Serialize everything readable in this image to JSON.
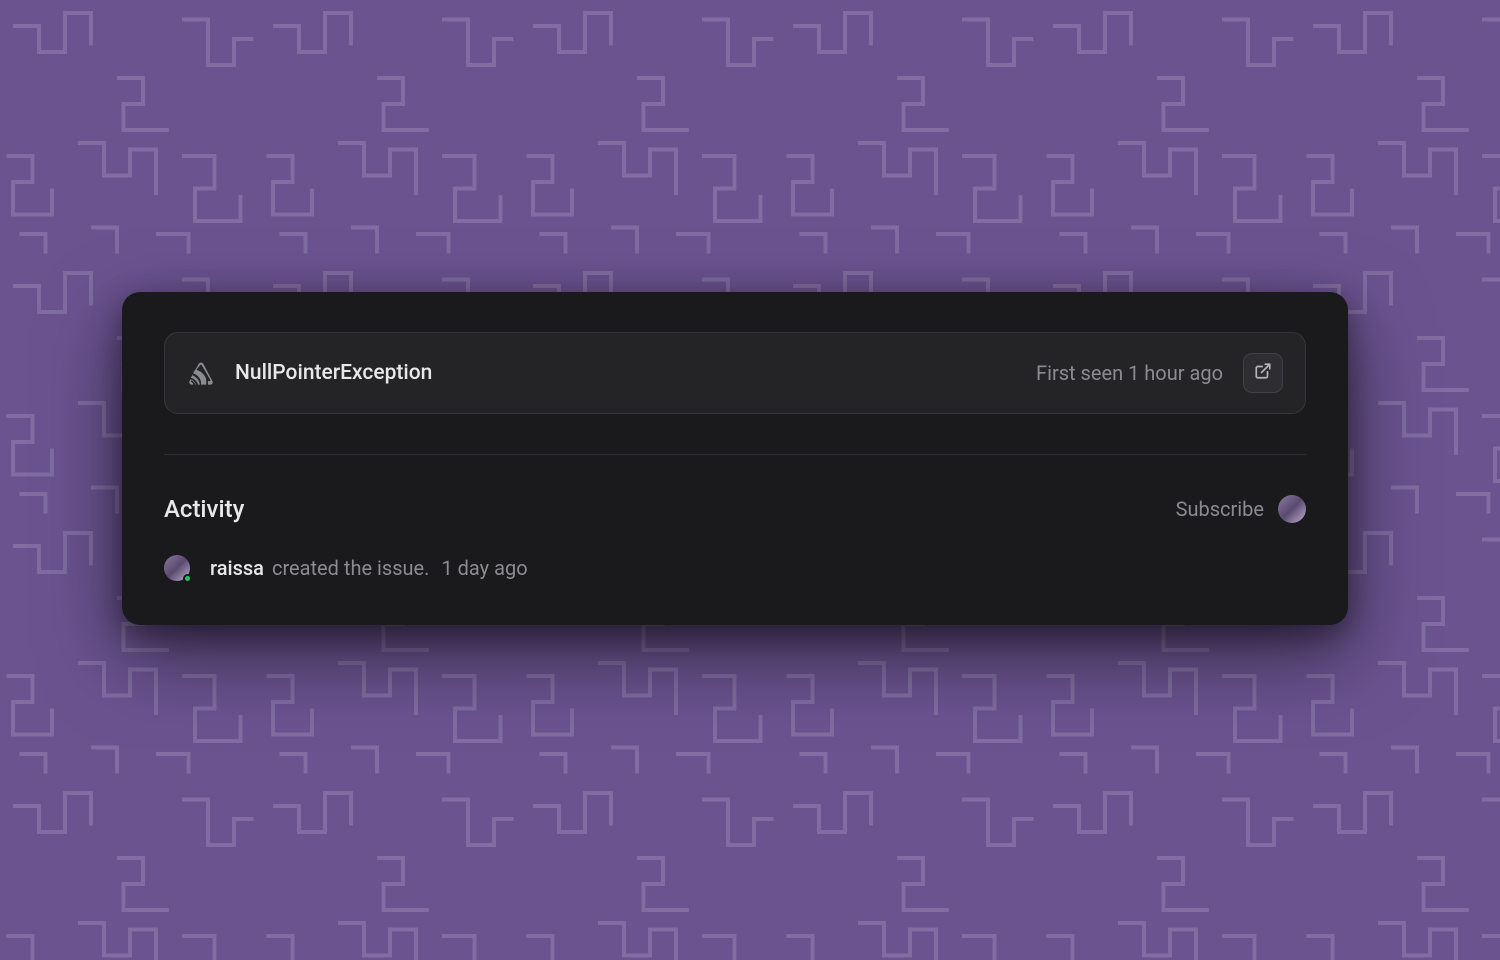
{
  "issue": {
    "title": "NullPointerException",
    "first_seen": "First seen 1 hour ago"
  },
  "activity": {
    "heading": "Activity",
    "subscribe_label": "Subscribe",
    "entries": [
      {
        "user": "raissa",
        "action": "created the issue.",
        "time": "1 day ago"
      }
    ]
  },
  "colors": {
    "background": "#6B5390",
    "card": "#1a1a1c",
    "issue_bar": "#242427",
    "text_primary": "#e8e8ea",
    "text_secondary": "#8b8b92"
  }
}
